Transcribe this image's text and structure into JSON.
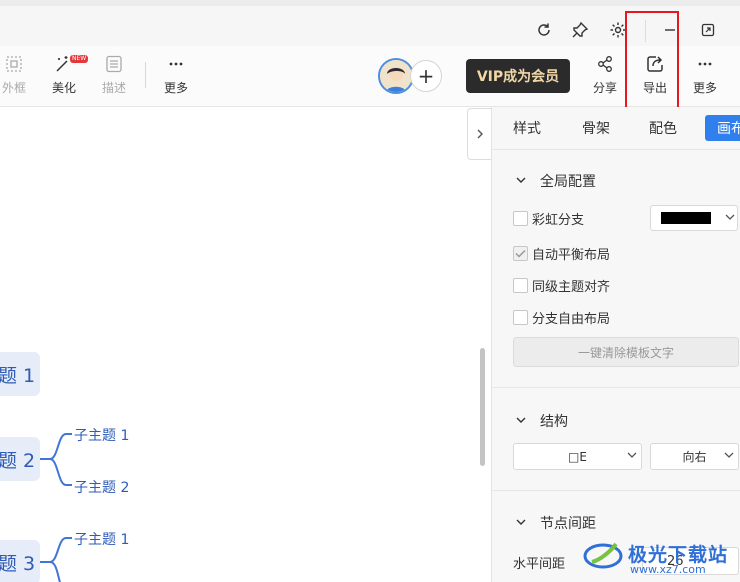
{
  "titlebar": {
    "icons": [
      "refresh-icon",
      "pin-icon",
      "gear-icon",
      "minimize-icon",
      "restore-icon"
    ]
  },
  "toolbar": {
    "frame_label": "外框",
    "beautify_label": "美化",
    "beautify_badge": "NEW",
    "describe_label": "描述",
    "more_left_label": "更多",
    "vip_label": "VIP成为会员",
    "share_label": "分享",
    "export_label": "导出",
    "more_right_label": "更多"
  },
  "canvas": {
    "topics": [
      {
        "label": "题 1"
      },
      {
        "label": "题 2",
        "subtopics": [
          "子主题 1",
          "子主题 2"
        ]
      },
      {
        "label": "题 3",
        "subtopics": [
          "子主题 1"
        ]
      }
    ],
    "branch_color": "#3f76d8"
  },
  "panel": {
    "tabs": [
      "样式",
      "骨架",
      "配色",
      "画布"
    ],
    "active_tab": "画布",
    "global_section": {
      "title": "全局配置",
      "rainbow_branch": "彩虹分支",
      "auto_balance": "自动平衡布局",
      "align_same_level": "同级主题对齐",
      "free_branch_layout": "分支自由布局",
      "clear_template_text": "一键清除模板文字",
      "branch_color": "#000000"
    },
    "structure_section": {
      "title": "结构",
      "layout_value": "□E",
      "direction_value": "向右"
    },
    "spacing_section": {
      "title": "节点间距",
      "horizontal_label": "水平间距",
      "horizontal_value": "26"
    }
  },
  "watermark": {
    "text": "极光下载站",
    "url": "www.xz7.com"
  },
  "accent_color": "#2f80ed",
  "highlight_color": "#e5191d"
}
